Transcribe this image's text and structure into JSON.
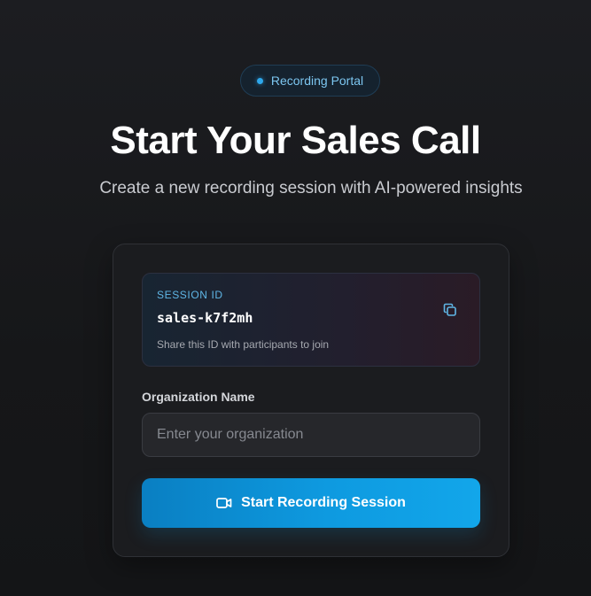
{
  "badge": {
    "label": "Recording Portal"
  },
  "header": {
    "title": "Start Your Sales Call",
    "subtitle": "Create a new recording session with AI-powered insights"
  },
  "session": {
    "label": "SESSION ID",
    "value": "sales-k7f2mh",
    "hint": "Share this ID with participants to join",
    "copy_icon": "copy-icon"
  },
  "organization": {
    "label": "Organization Name",
    "value": "",
    "placeholder": "Enter your organization"
  },
  "start_button": {
    "label": "Start Recording Session",
    "icon": "video-camera-icon"
  },
  "colors": {
    "accent": "#0e9ae0",
    "badge_dot": "#2ea8ec",
    "background": "#18191c"
  }
}
